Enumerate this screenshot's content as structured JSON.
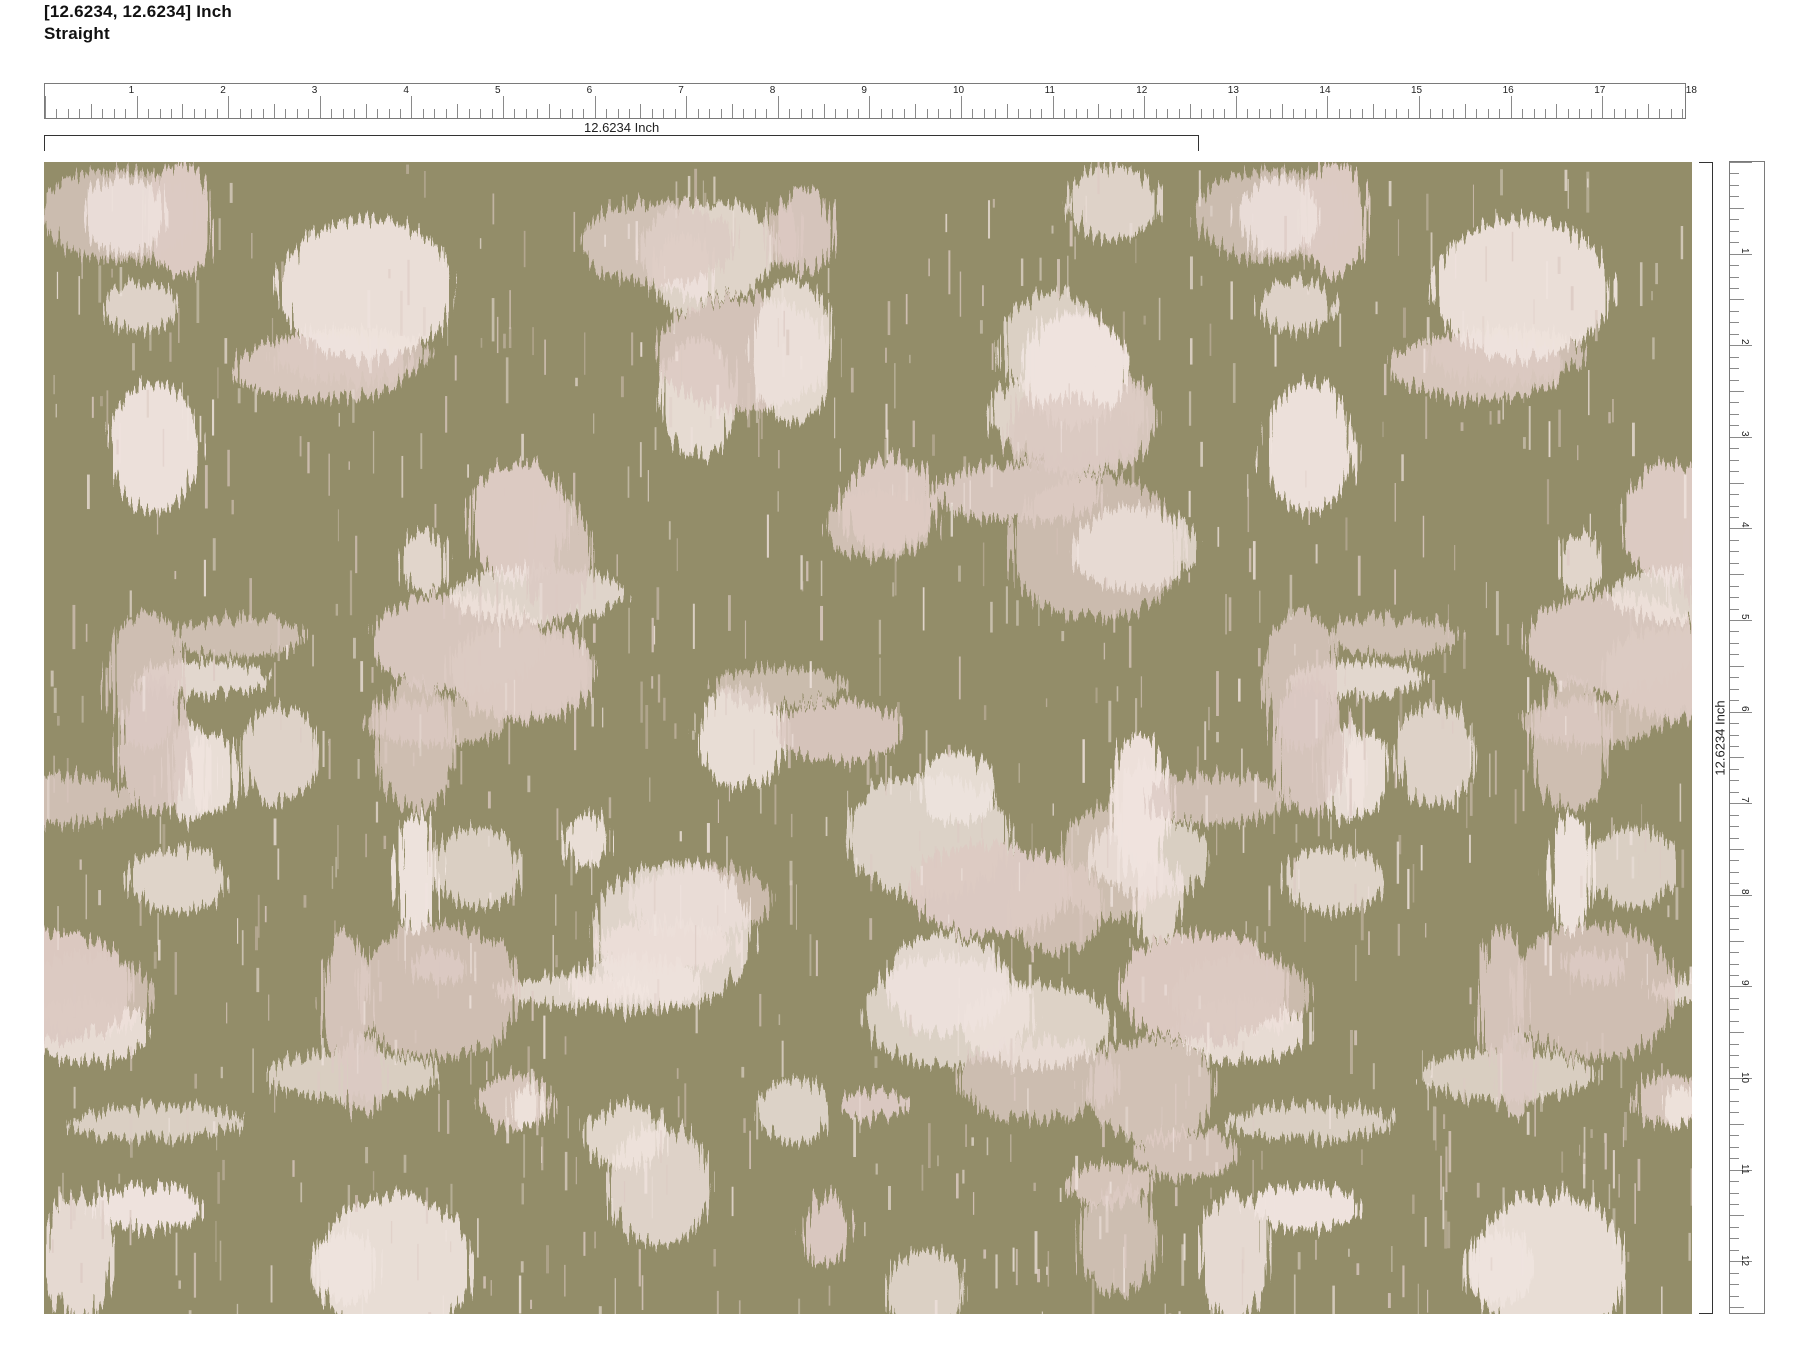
{
  "header": {
    "repeat_size": "[12.6234, 12.6234] Inch",
    "repeat_type": "Straight"
  },
  "rulers": {
    "horizontal_labels": [
      "1",
      "2",
      "3",
      "4",
      "5",
      "6",
      "7",
      "8",
      "9",
      "10",
      "11",
      "12",
      "13",
      "14",
      "15",
      "16",
      "17",
      "18"
    ],
    "vertical_labels": [
      "1",
      "2",
      "3",
      "4",
      "5",
      "6",
      "7",
      "8",
      "9",
      "10",
      "11",
      "12"
    ],
    "horizontal_max_inch": 18,
    "vertical_max_inch": 12.6234
  },
  "dimensions": {
    "width_label": "12.6234 Inch",
    "height_label": "12.6234 Inch",
    "tile_width_inch": 12.6234
  },
  "pattern": {
    "style": "ikat floral",
    "colors": {
      "background": "#938d69",
      "blush": "#dccac3",
      "highlight": "#efe3de"
    }
  }
}
